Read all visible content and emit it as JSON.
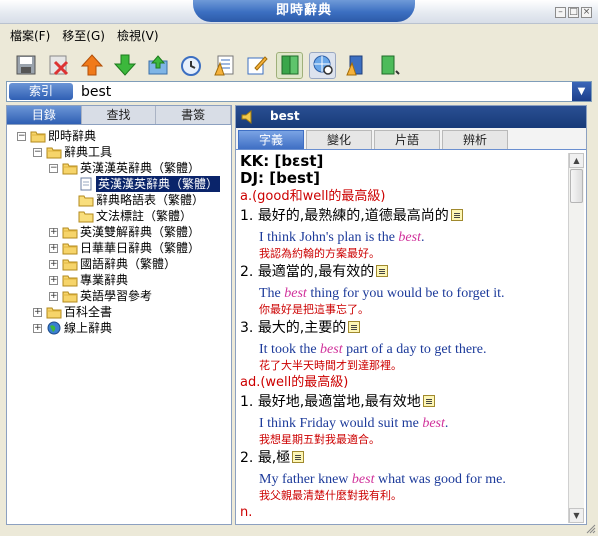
{
  "window": {
    "title": "即時辭典"
  },
  "menu": [
    "檔案(F)",
    "移至(G)",
    "檢視(V)"
  ],
  "toolbar": {
    "icons": [
      "save-icon",
      "delete-icon",
      "up-arrow-icon",
      "down-arrow-icon",
      "export-icon",
      "history-icon",
      "notes-icon",
      "edit-icon",
      "dictionary-book-icon",
      "web-search-icon",
      "bookmark-book-icon",
      "book-settings-icon"
    ]
  },
  "search": {
    "tab_label": "索引",
    "value": "best"
  },
  "left_tabs": [
    "目錄",
    "查找",
    "書簽"
  ],
  "tree": [
    {
      "label": "即時辭典",
      "level": 0,
      "expander": "−",
      "icon": "folder"
    },
    {
      "label": "辭典工具",
      "level": 1,
      "expander": "−",
      "icon": "folder"
    },
    {
      "label": "英漢漢英辭典（繁體）",
      "level": 2,
      "expander": "−",
      "icon": "folder"
    },
    {
      "label": "英漢漢英辭典（繁體）",
      "level": 3,
      "expander": "",
      "icon": "doc",
      "selected": true
    },
    {
      "label": "辭典略語表（繁體）",
      "level": 3,
      "expander": "",
      "icon": "folder-plain"
    },
    {
      "label": "文法標註（繁體）",
      "level": 3,
      "expander": "",
      "icon": "folder-plain"
    },
    {
      "label": "英漢雙解辭典（繁體）",
      "level": 2,
      "expander": "+",
      "icon": "folder"
    },
    {
      "label": "日華華日辭典（繁體）",
      "level": 2,
      "expander": "+",
      "icon": "folder"
    },
    {
      "label": "國語辭典（繁體）",
      "level": 2,
      "expander": "+",
      "icon": "folder"
    },
    {
      "label": "專業辭典",
      "level": 2,
      "expander": "+",
      "icon": "folder"
    },
    {
      "label": "英語學習參考",
      "level": 2,
      "expander": "+",
      "icon": "folder"
    },
    {
      "label": "百科全書",
      "level": 1,
      "expander": "+",
      "icon": "folder"
    },
    {
      "label": "線上辭典",
      "level": 1,
      "expander": "+",
      "icon": "globe"
    }
  ],
  "entry": {
    "word": "best",
    "tabs": [
      "字義",
      "變化",
      "片語",
      "辨析"
    ],
    "phonetics": [
      "KK: [bɛst]",
      "DJ: [best]"
    ],
    "pos_adj": "a.(good和well的最高級)",
    "pos_adv": "ad.(well的最高級)",
    "pos_n": "n.",
    "senses_adj": [
      {
        "num": "1.",
        "def": "最好的,最熟練的,道德最高尚的",
        "ex_pre": "I think John's plan is the ",
        "ex_hl": "best",
        "ex_post": ".",
        "zh": "我認為約翰的方案最好。"
      },
      {
        "num": "2.",
        "def": "最適當的,最有效的",
        "ex_pre": "The ",
        "ex_hl": "best",
        "ex_post": " thing for you would be to forget it.",
        "zh": "你最好是把這事忘了。"
      },
      {
        "num": "3.",
        "def": "最大的,主要的",
        "ex_pre": "It took the ",
        "ex_hl": "best",
        "ex_post": " part of a day to get there.",
        "zh": "花了大半天時間才到達那裡。"
      }
    ],
    "senses_adv": [
      {
        "num": "1.",
        "def": "最好地,最適當地,最有效地",
        "ex_pre": "I think Friday would suit me ",
        "ex_hl": "best",
        "ex_post": ".",
        "zh": "我想星期五對我最適合。"
      },
      {
        "num": "2.",
        "def": "最,極",
        "ex_pre": "My father knew ",
        "ex_hl": "best",
        "ex_post": " what was good for me.",
        "zh": "我父親最清楚什麼對我有利。"
      }
    ]
  },
  "colors": {
    "accent": "#2c5aa8",
    "header": "#1c3f80",
    "pos": "#cc0000",
    "example": "#1c3a9a",
    "highlight": "#d0309a"
  }
}
